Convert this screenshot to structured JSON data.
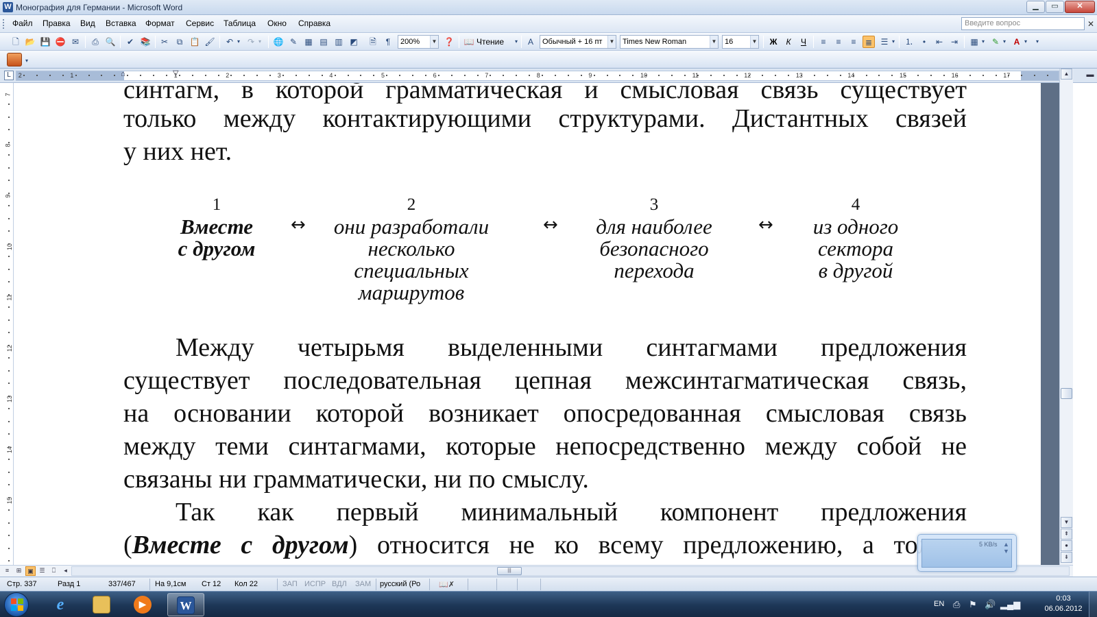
{
  "window": {
    "title": "Монография для Германии - Microsoft Word",
    "app_icon": "W"
  },
  "menu": {
    "items": [
      "Файл",
      "Правка",
      "Вид",
      "Вставка",
      "Формат",
      "Сервис",
      "Таблица",
      "Окно",
      "Справка"
    ],
    "question_placeholder": "Введите вопрос"
  },
  "toolbar": {
    "zoom": "200%",
    "reading_label": "Чтение",
    "style": "Обычный + 16 пт",
    "font": "Times New Roman",
    "font_size": "16",
    "bold": "Ж",
    "italic": "К",
    "underline": "Ч"
  },
  "ruler": {
    "numbers": [
      "2",
      "1",
      "1",
      "2",
      "3",
      "4",
      "5",
      "6",
      "7",
      "8",
      "9",
      "10",
      "11",
      "12",
      "13",
      "14",
      "15",
      "16",
      "17"
    ],
    "vertical_numbers": [
      "7",
      "8",
      "9",
      "10",
      "11",
      "12",
      "13",
      "14",
      "15"
    ]
  },
  "document": {
    "top_lines": [
      "синтагм, в которой грамматическая и смысловая связь существует",
      "только между контактирующими структурами. Дистантных связей",
      "у них нет."
    ],
    "scheme": [
      {
        "number": "1",
        "lines": [
          "Вместе",
          "с другом"
        ],
        "bold": true
      },
      {
        "number": "2",
        "lines": [
          "они разработали",
          "несколько",
          "специальных",
          "маршрутов"
        ],
        "bold": false
      },
      {
        "number": "3",
        "lines": [
          "для наиболее",
          "безопасного",
          "перехода"
        ],
        "bold": false
      },
      {
        "number": "4",
        "lines": [
          "из одного",
          "сектора",
          "в другой"
        ],
        "bold": false
      }
    ],
    "arrow": "↔",
    "paragraph1": [
      "Между четырьмя выделенными синтагмами предложения",
      "существует последовательная цепная межсинтагматическая связь,",
      "на основании которой возникает опосредованная смысловая связь",
      "между теми синтагмами, которые непосредственно между собой не",
      "связаны ни грамматически, ни по смыслу."
    ],
    "paragraph2_line1": "Так как первый минимальный компонент предложения",
    "paragraph2_line2_open": "(",
    "paragraph2_line2_bold": "Вместе с другом",
    "paragraph2_line2_rest": ") относится не ко всему предложению, а только"
  },
  "status": {
    "page": "Стр. 337",
    "section": "Разд 1",
    "pages": "337/467",
    "at": "На 9,1см",
    "line": "Ст 12",
    "col": "Кол 22",
    "rec": "ЗАП",
    "trk": "ИСПР",
    "ext": "ВДЛ",
    "ovr": "ЗАМ",
    "language": "русский (Ро"
  },
  "network_widget": {
    "speed": "5 KB/s"
  },
  "taskbar": {
    "language": "EN",
    "time": "0:03",
    "date": "06.06.2012"
  }
}
